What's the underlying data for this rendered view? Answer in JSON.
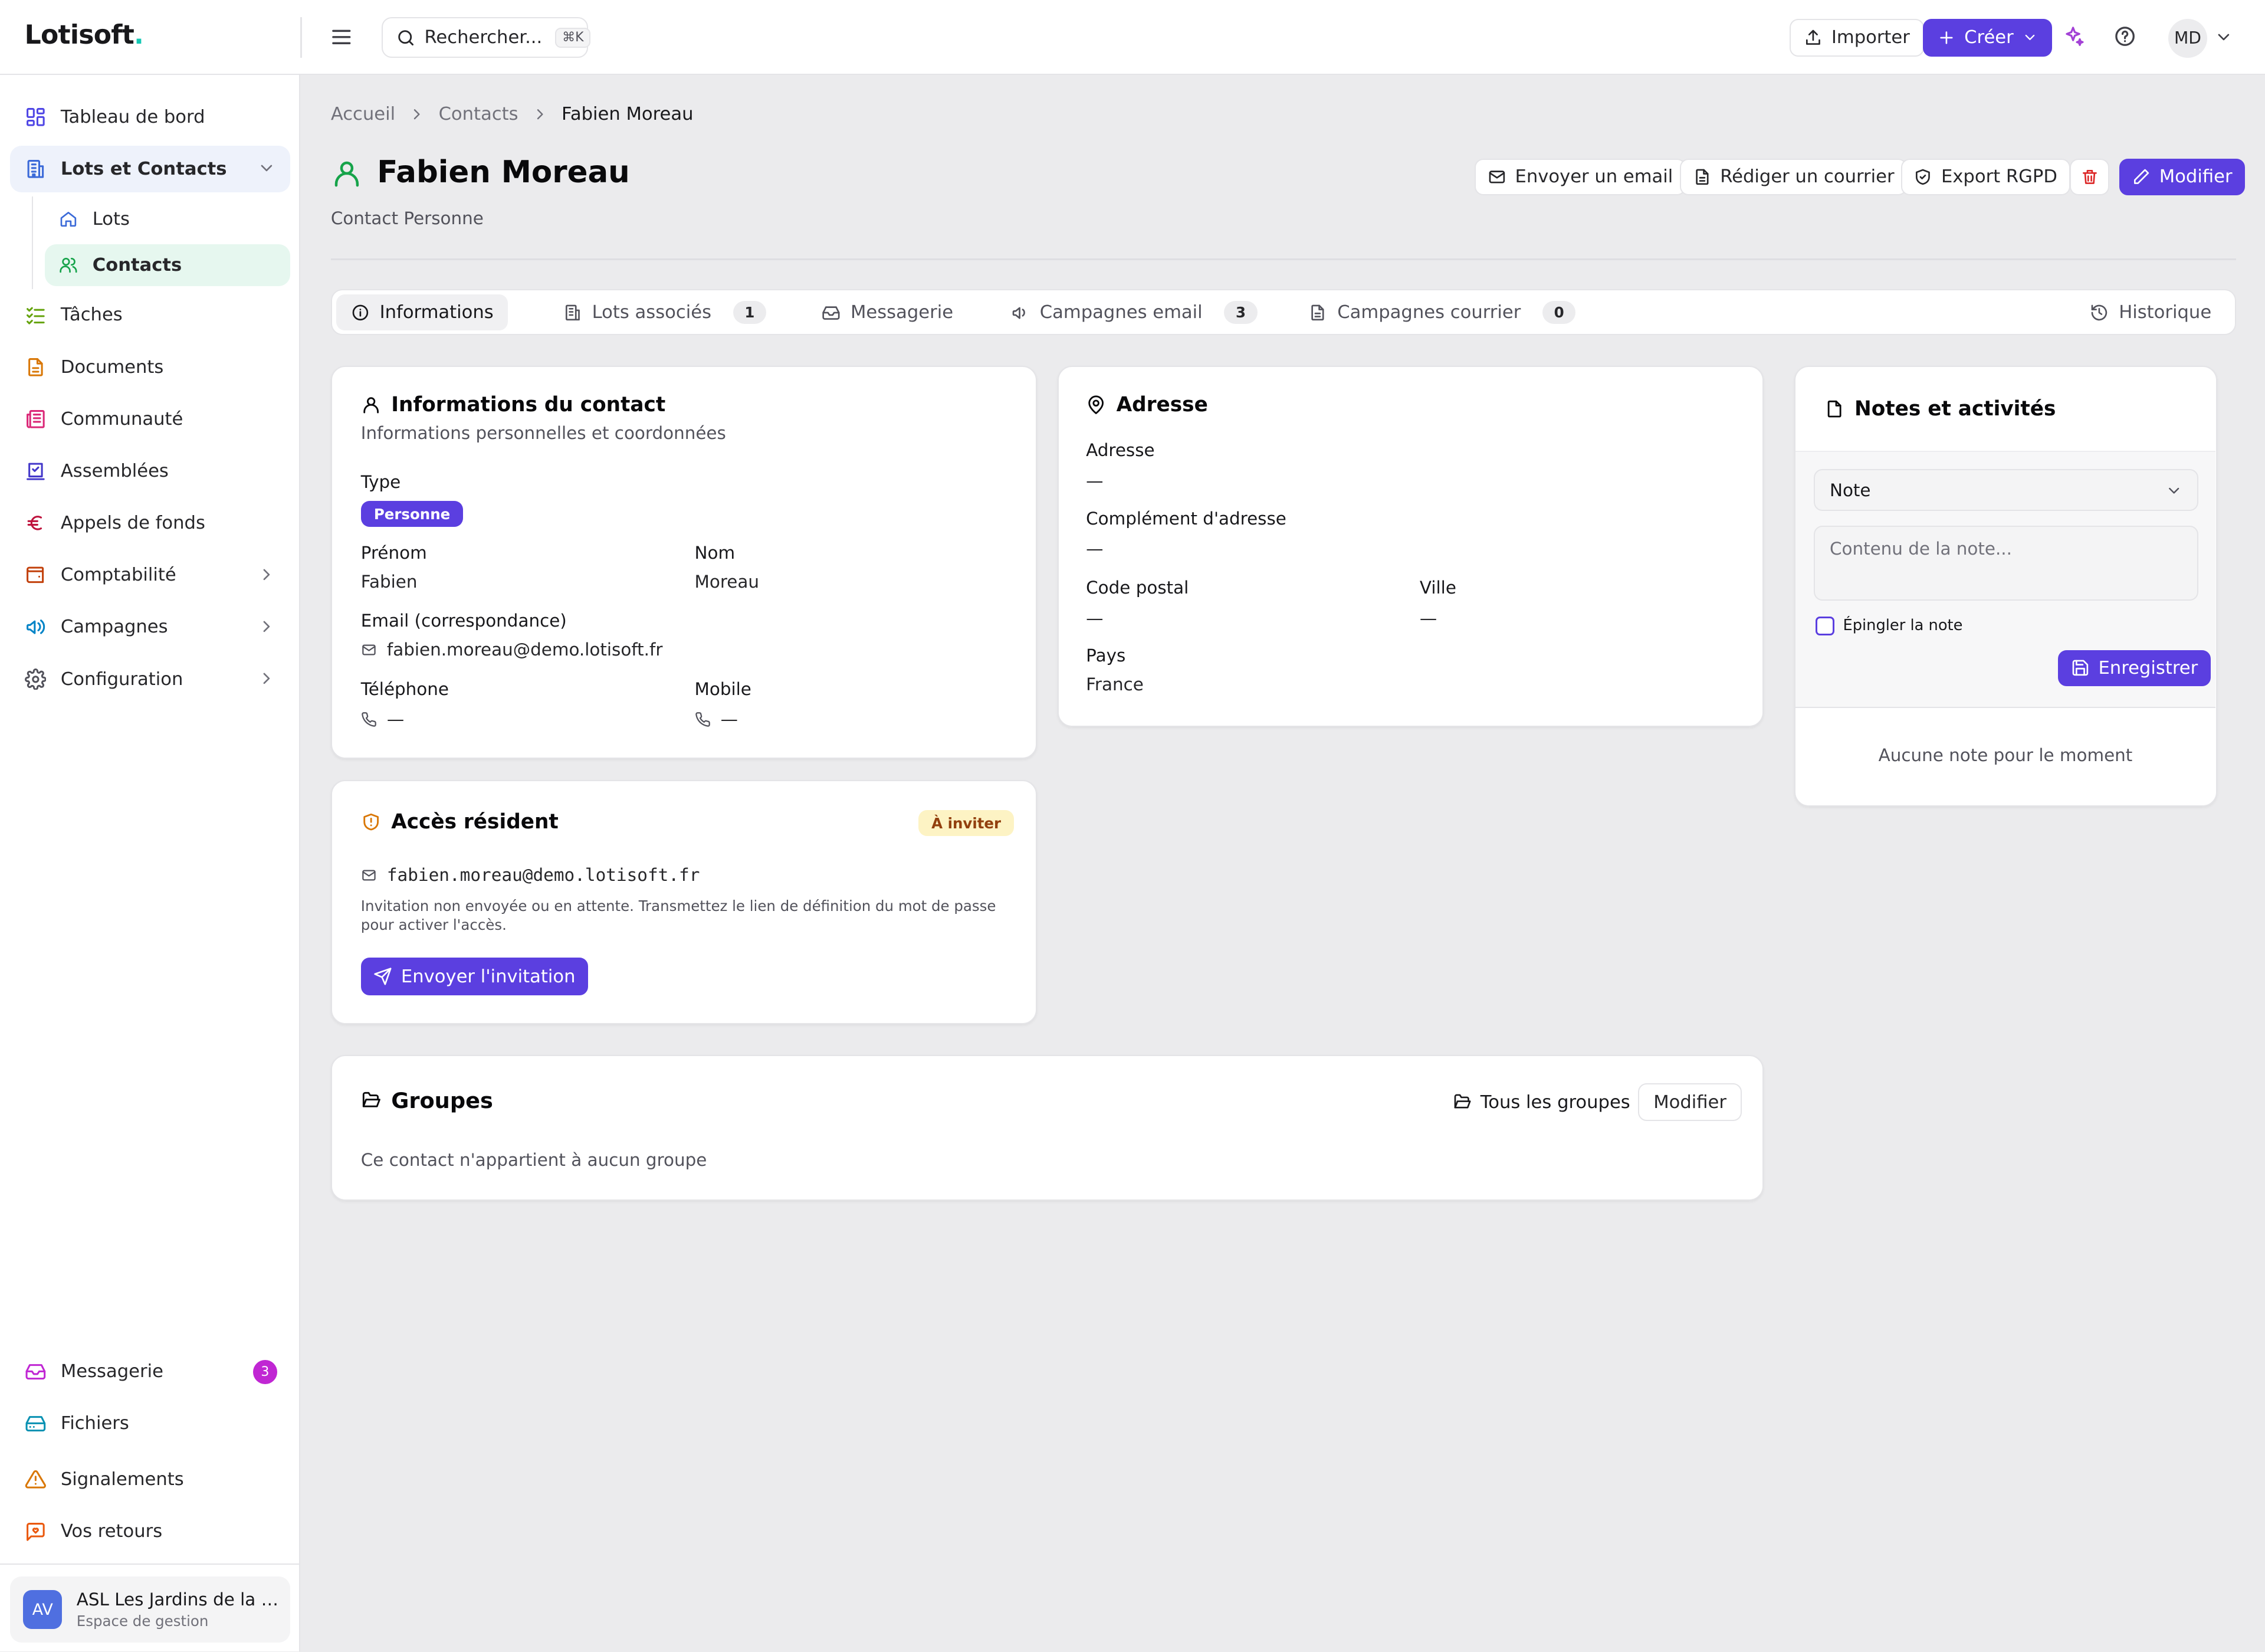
{
  "app": {
    "logo": "Lotisoft",
    "logo_dot": "."
  },
  "topbar": {
    "search_label": "Rechercher...",
    "search_shortcut": "⌘K",
    "import_label": "Importer",
    "create_label": "Créer",
    "user_initials": "MD"
  },
  "sidebar": {
    "items": [
      {
        "label": "Tableau de bord"
      },
      {
        "label": "Lots et Contacts"
      },
      {
        "label": "Lots"
      },
      {
        "label": "Contacts"
      },
      {
        "label": "Tâches"
      },
      {
        "label": "Documents"
      },
      {
        "label": "Communauté"
      },
      {
        "label": "Assemblées"
      },
      {
        "label": "Appels de fonds"
      },
      {
        "label": "Comptabilité"
      },
      {
        "label": "Campagnes"
      },
      {
        "label": "Configuration"
      }
    ],
    "bottom": [
      {
        "label": "Messagerie",
        "badge": "3"
      },
      {
        "label": "Fichiers"
      },
      {
        "label": "Signalements"
      },
      {
        "label": "Vos retours"
      }
    ],
    "org": {
      "avatar": "AV",
      "name": "ASL Les Jardins de la Vallée",
      "subtitle": "Espace de gestion"
    }
  },
  "breadcrumb": [
    "Accueil",
    "Contacts",
    "Fabien Moreau"
  ],
  "header": {
    "title": "Fabien Moreau",
    "subtitle": "Contact Personne",
    "actions": {
      "email": "Envoyer un email",
      "courrier": "Rédiger un courrier",
      "rgpd": "Export RGPD",
      "edit": "Modifier"
    }
  },
  "tabs": [
    {
      "label": "Informations"
    },
    {
      "label": "Lots associés",
      "count": "1"
    },
    {
      "label": "Messagerie"
    },
    {
      "label": "Campagnes email",
      "count": "3"
    },
    {
      "label": "Campagnes courrier",
      "count": "0"
    },
    {
      "label": "Historique"
    }
  ],
  "contact_info": {
    "title": "Informations du contact",
    "subtitle": "Informations personnelles et coordonnées",
    "type_label": "Type",
    "type_value": "Personne",
    "firstname_label": "Prénom",
    "firstname_value": "Fabien",
    "lastname_label": "Nom",
    "lastname_value": "Moreau",
    "email_label": "Email (correspondance)",
    "email_value": "fabien.moreau@demo.lotisoft.fr",
    "phone_label": "Téléphone",
    "phone_value": "—",
    "mobile_label": "Mobile",
    "mobile_value": "—"
  },
  "address": {
    "title": "Adresse",
    "address_label": "Adresse",
    "address_value": "—",
    "complement_label": "Complément d'adresse",
    "complement_value": "—",
    "postal_label": "Code postal",
    "postal_value": "—",
    "city_label": "Ville",
    "city_value": "—",
    "country_label": "Pays",
    "country_value": "France"
  },
  "resident_access": {
    "title": "Accès résident",
    "status": "À inviter",
    "email": "fabien.moreau@demo.lotisoft.fr",
    "note": "Invitation non envoyée ou en attente. Transmettez le lien de définition du mot de passe pour activer l'accès.",
    "button": "Envoyer l'invitation"
  },
  "notes": {
    "title": "Notes et activités",
    "select_value": "Note",
    "placeholder": "Contenu de la note...",
    "pin_label": "Épingler la note",
    "save_label": "Enregistrer",
    "empty": "Aucune note pour le moment"
  },
  "groups": {
    "title": "Groupes",
    "all_label": "Tous les groupes",
    "edit_label": "Modifier",
    "empty": "Ce contact n'appartient à aucun groupe"
  },
  "colors": {
    "primary": "#5b3fe0",
    "logo_dot": "#14c8b4",
    "badge_pink": "#c026d3",
    "status_amber_bg": "#fdf3c4",
    "delete_red": "#dc2626"
  }
}
